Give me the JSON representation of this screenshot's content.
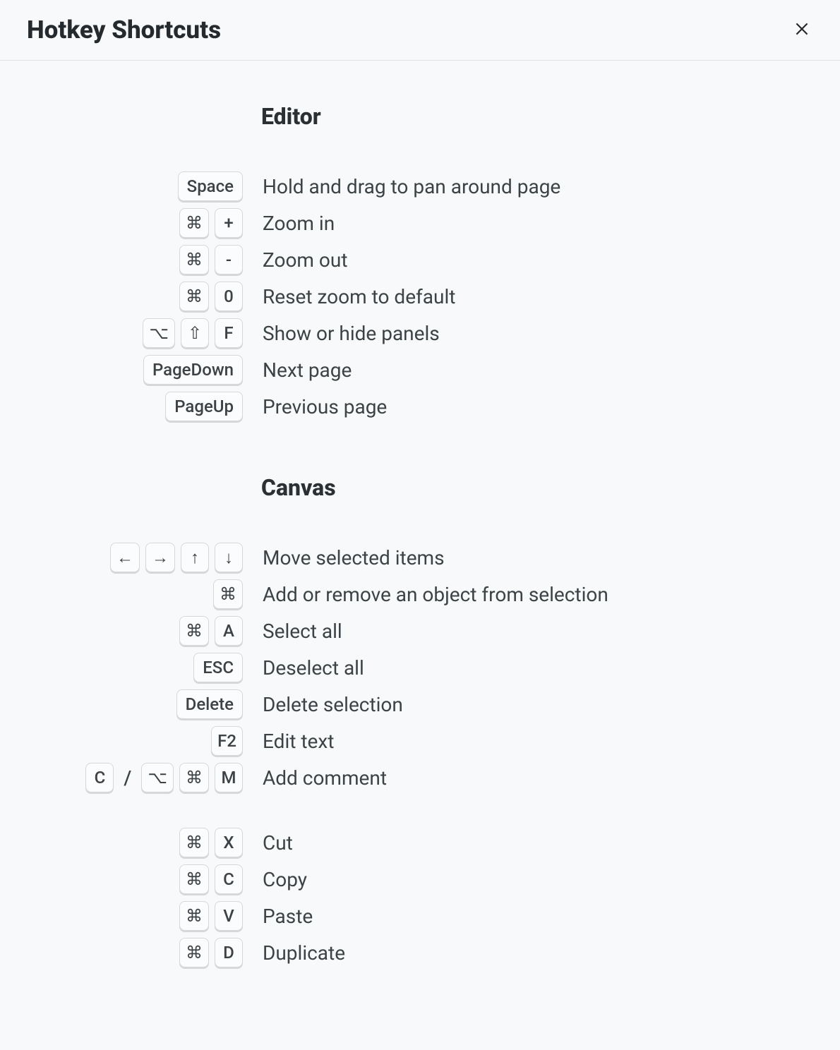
{
  "dialog": {
    "title": "Hotkey Shortcuts"
  },
  "specialKeys": {
    "cmd": "⌘",
    "option": "⌥",
    "shift": "⇧",
    "arrowLeft": "←",
    "arrowRight": "→",
    "arrowUp": "↑",
    "arrowDown": "↓"
  },
  "sections": [
    {
      "title": "Editor",
      "rows": [
        {
          "keys": [
            [
              "Space"
            ]
          ],
          "desc": "Hold and drag to pan around page"
        },
        {
          "keys": [
            [
              "cmd",
              "+"
            ]
          ],
          "desc": "Zoom in"
        },
        {
          "keys": [
            [
              "cmd",
              "-"
            ]
          ],
          "desc": "Zoom out"
        },
        {
          "keys": [
            [
              "cmd",
              "0"
            ]
          ],
          "desc": "Reset zoom to default"
        },
        {
          "keys": [
            [
              "option",
              "shift",
              "F"
            ]
          ],
          "desc": "Show or hide panels"
        },
        {
          "keys": [
            [
              "PageDown"
            ]
          ],
          "desc": "Next page"
        },
        {
          "keys": [
            [
              "PageUp"
            ]
          ],
          "desc": "Previous page"
        }
      ]
    },
    {
      "title": "Canvas",
      "rows": [
        {
          "keys": [
            [
              "arrowLeft",
              "arrowRight",
              "arrowUp",
              "arrowDown"
            ]
          ],
          "desc": "Move selected items"
        },
        {
          "keys": [
            [
              "cmd"
            ]
          ],
          "desc": "Add or remove an object from selection"
        },
        {
          "keys": [
            [
              "cmd",
              "A"
            ]
          ],
          "desc": "Select all"
        },
        {
          "keys": [
            [
              "ESC"
            ]
          ],
          "desc": "Deselect all"
        },
        {
          "keys": [
            [
              "Delete"
            ]
          ],
          "desc": "Delete selection"
        },
        {
          "keys": [
            [
              "F2"
            ]
          ],
          "desc": "Edit text"
        },
        {
          "keys": [
            [
              "C"
            ],
            [
              "option",
              "cmd",
              "M"
            ]
          ],
          "desc": "Add comment"
        },
        {
          "spacer": true
        },
        {
          "keys": [
            [
              "cmd",
              "X"
            ]
          ],
          "desc": "Cut"
        },
        {
          "keys": [
            [
              "cmd",
              "C"
            ]
          ],
          "desc": "Copy"
        },
        {
          "keys": [
            [
              "cmd",
              "V"
            ]
          ],
          "desc": "Paste"
        },
        {
          "keys": [
            [
              "cmd",
              "D"
            ]
          ],
          "desc": "Duplicate"
        }
      ]
    }
  ],
  "comboSeparator": "/"
}
